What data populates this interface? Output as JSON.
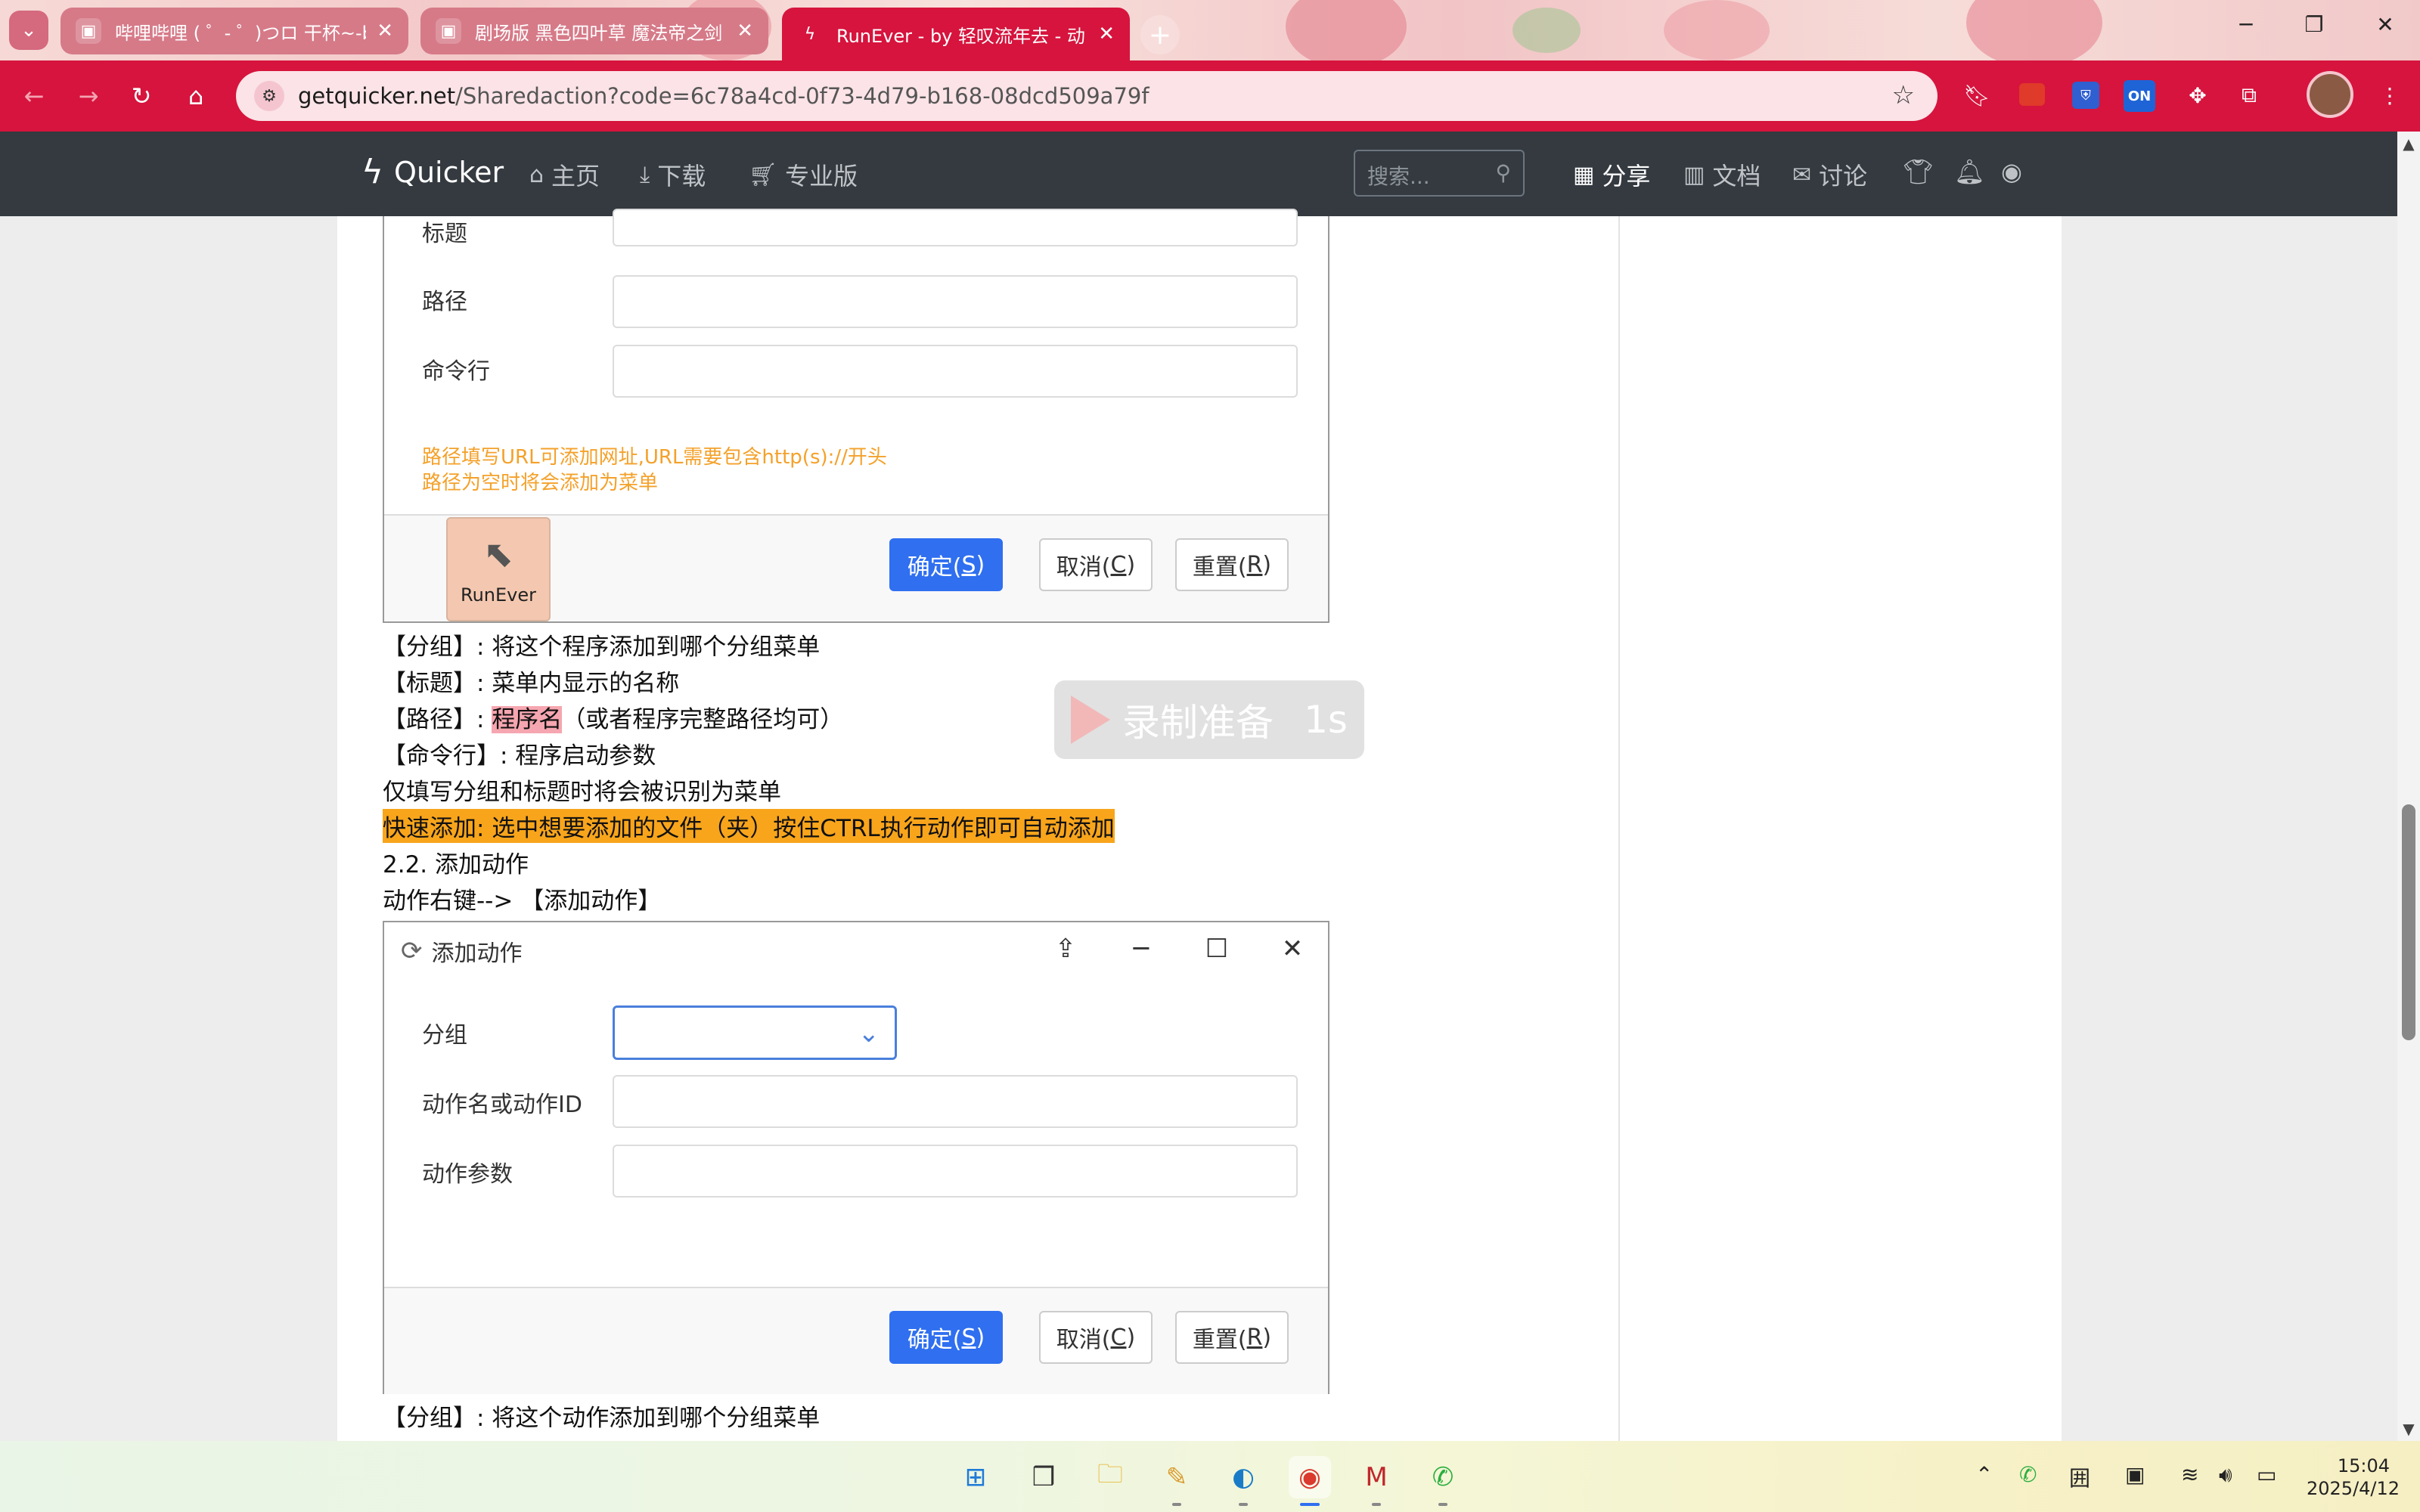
{
  "browser": {
    "tabs": [
      {
        "title": "哔哩哔哩 ( ゜- ゜)つロ 干杯~-bi",
        "favicon": "bilibili-icon",
        "active": false
      },
      {
        "title": "剧场版 黑色四叶草 魔法帝之剑",
        "favicon": "bilibili-icon",
        "active": false
      },
      {
        "title": "RunEver - by 轻叹流年去 - 动",
        "favicon": "quicker-icon",
        "active": true
      }
    ],
    "url_host": "getquicker.net",
    "url_path": "/Sharedaction?code=6c78a4cd-0f73-4d79-b168-08dcd509a79f",
    "extension_on_label": "ON",
    "accent_color": "#d6143d"
  },
  "sitenav": {
    "brand": "Quicker",
    "links": [
      "主页",
      "下载",
      "专业版"
    ],
    "search_placeholder": "搜索...",
    "right_links": [
      "分享",
      "文档",
      "讨论"
    ]
  },
  "dialog1": {
    "labels": {
      "title": "标题",
      "path": "路径",
      "cmd": "命令行"
    },
    "hint1": "路径填写URL可添加网址,URL需要包含http(s)://开头",
    "hint2": "路径为空时将会添加为菜单",
    "ok_label": "确定(",
    "ok_key": "S",
    "cancel_label": "取消(",
    "cancel_key": "C",
    "reset_label": "重置(",
    "reset_key": "R",
    "close_paren": ")",
    "runever_label": "RunEver"
  },
  "doc_lines": {
    "line1": "【分组】: 将这个程序添加到哪个分组菜单",
    "line2": "【标题】: 菜单内显示的名称",
    "line3_prefix": "【路径】: ",
    "line3_highlight": "程序名",
    "line3_suffix": "（或者程序完整路径均可）",
    "line4": "【命令行】: 程序启动参数",
    "line5": "仅填写分组和标题时将会被识别为菜单",
    "line6": "快速添加: 选中想要添加的文件（夹）按住CTRL执行动作即可自动添加",
    "line7": "2.2. 添加动作",
    "line8": "动作右键--> 【添加动作】",
    "line9": "【分组】: 将这个动作添加到哪个分组菜单"
  },
  "dialog2": {
    "title": "添加动作",
    "labels": {
      "group": "分组",
      "action": "动作名或动作ID",
      "params": "动作参数"
    }
  },
  "recording": {
    "label": "录制准备",
    "seconds": "1s"
  },
  "taskbar": {
    "time": "15:04",
    "date": "2025/4/12",
    "ime_label": "囲"
  }
}
